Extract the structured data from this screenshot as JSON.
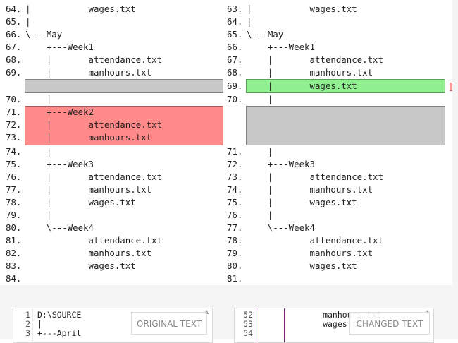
{
  "left_lines": [
    {
      "num": "64.",
      "text": "|           wages.txt"
    },
    {
      "num": "65.",
      "text": "|"
    },
    {
      "num": "66.",
      "text": "\\---May"
    },
    {
      "num": "67.",
      "text": "    +---Week1"
    },
    {
      "num": "68.",
      "text": "    |       attendance.txt"
    },
    {
      "num": "69.",
      "text": "    |       manhours.txt"
    },
    {
      "num": "70.",
      "text": "    |"
    },
    {
      "num": "71.",
      "text": "    +---Week2"
    },
    {
      "num": "72.",
      "text": "    |       attendance.txt"
    },
    {
      "num": "73.",
      "text": "    |       manhours.txt"
    },
    {
      "num": "74.",
      "text": "    |"
    },
    {
      "num": "75.",
      "text": "    +---Week3"
    },
    {
      "num": "76.",
      "text": "    |       attendance.txt"
    },
    {
      "num": "77.",
      "text": "    |       manhours.txt"
    },
    {
      "num": "78.",
      "text": "    |       wages.txt"
    },
    {
      "num": "79.",
      "text": "    |"
    },
    {
      "num": "80.",
      "text": "    \\---Week4"
    },
    {
      "num": "81.",
      "text": "            attendance.txt"
    },
    {
      "num": "82.",
      "text": "            manhours.txt"
    },
    {
      "num": "83.",
      "text": "            wages.txt"
    },
    {
      "num": "84.",
      "text": ""
    }
  ],
  "right_lines": [
    {
      "num": "63.",
      "text": "|           wages.txt"
    },
    {
      "num": "64.",
      "text": "|"
    },
    {
      "num": "65.",
      "text": "\\---May"
    },
    {
      "num": "66.",
      "text": "    +---Week1"
    },
    {
      "num": "67.",
      "text": "    |       attendance.txt"
    },
    {
      "num": "68.",
      "text": "    |       manhours.txt"
    },
    {
      "num": "69.",
      "text": "    |       wages.txt"
    },
    {
      "num": "70.",
      "text": "    |"
    },
    {
      "num": "71.",
      "text": "    |"
    },
    {
      "num": "72.",
      "text": "    +---Week3"
    },
    {
      "num": "73.",
      "text": "    |       attendance.txt"
    },
    {
      "num": "74.",
      "text": "    |       manhours.txt"
    },
    {
      "num": "75.",
      "text": "    |       wages.txt"
    },
    {
      "num": "76.",
      "text": "    |"
    },
    {
      "num": "77.",
      "text": "    \\---Week4"
    },
    {
      "num": "78.",
      "text": "            attendance.txt"
    },
    {
      "num": "79.",
      "text": "            manhours.txt"
    },
    {
      "num": "80.",
      "text": "            wages.txt"
    },
    {
      "num": "81.",
      "text": ""
    }
  ],
  "preview_left": [
    {
      "num": "1",
      "text": "D:\\SOURCE"
    },
    {
      "num": "2",
      "text": "|"
    },
    {
      "num": "3",
      "text": "+---April"
    }
  ],
  "preview_right": [
    {
      "num": "52",
      "text": "            manhours.txt"
    },
    {
      "num": "53",
      "text": "            wages.txt"
    },
    {
      "num": "54",
      "text": ""
    }
  ],
  "labels": {
    "original": "ORIGINAL TEXT",
    "changed": "CHANGED TEXT"
  },
  "colors": {
    "removed": "#ff8a8a",
    "added": "#90f090",
    "placeholder": "#c8c8c8"
  }
}
